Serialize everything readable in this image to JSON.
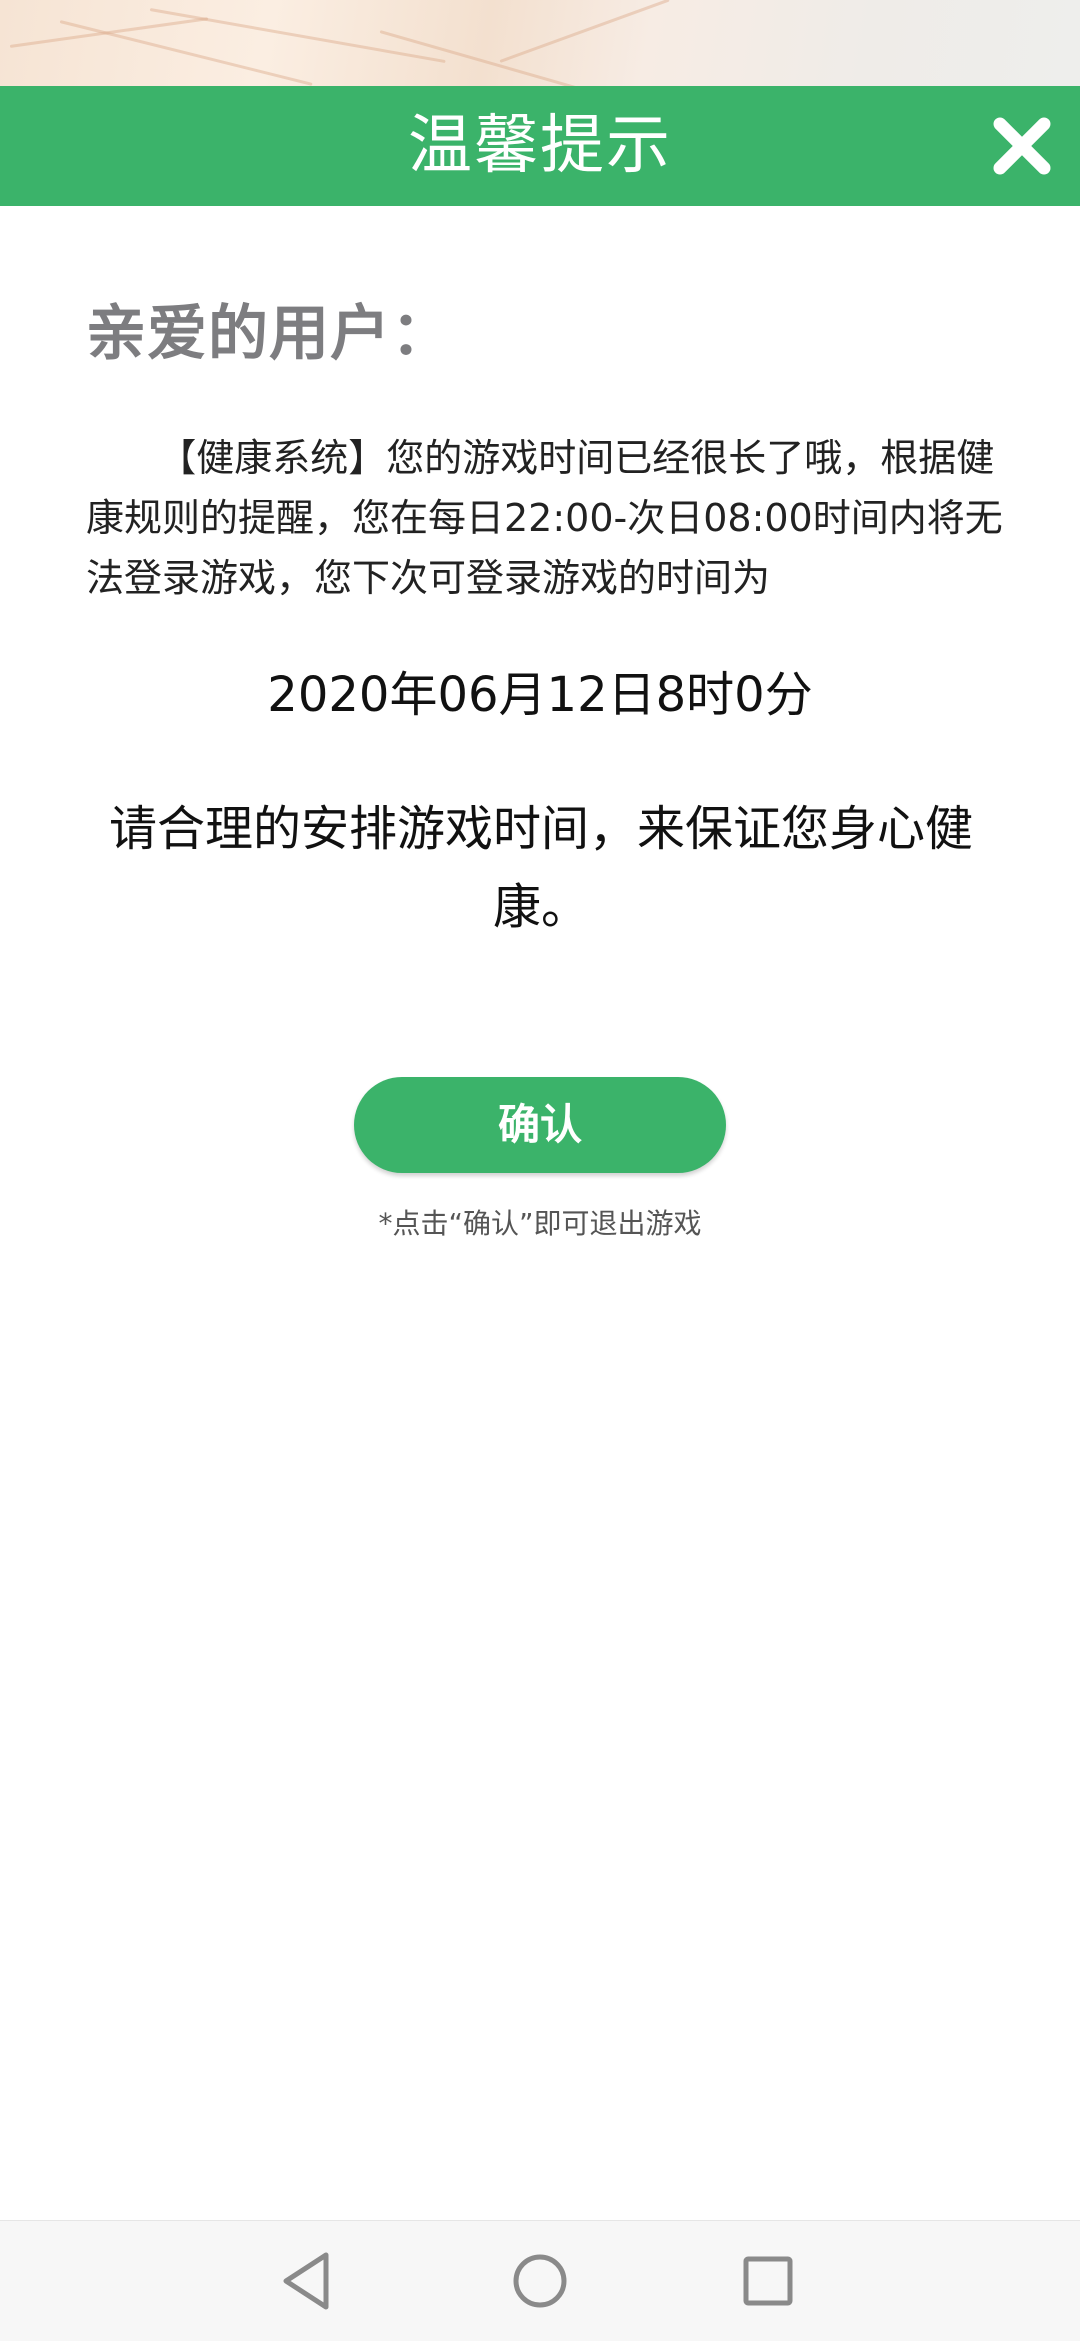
{
  "dialog": {
    "title": "温馨提示",
    "close_icon": "close-icon",
    "greeting": "亲爱的用户：",
    "message": "【健康系统】您的游戏时间已经很长了哦，根据健康规则的提醒，您在每日22:00-次日08:00时间内将无法登录游戏，您下次可登录游戏的时间为",
    "next_login_time": "2020年06月12日8时0分",
    "advice": "请合理的安排游戏时间，来保证您身心健康。",
    "confirm_label": "确认",
    "hint": "*点击“确认”即可退出游戏"
  },
  "navbar": {
    "back_icon": "back-triangle-icon",
    "home_icon": "home-circle-icon",
    "recents_icon": "recents-square-icon"
  },
  "colors": {
    "accent": "#3bb36a",
    "greeting_gray": "#7d7d80"
  }
}
